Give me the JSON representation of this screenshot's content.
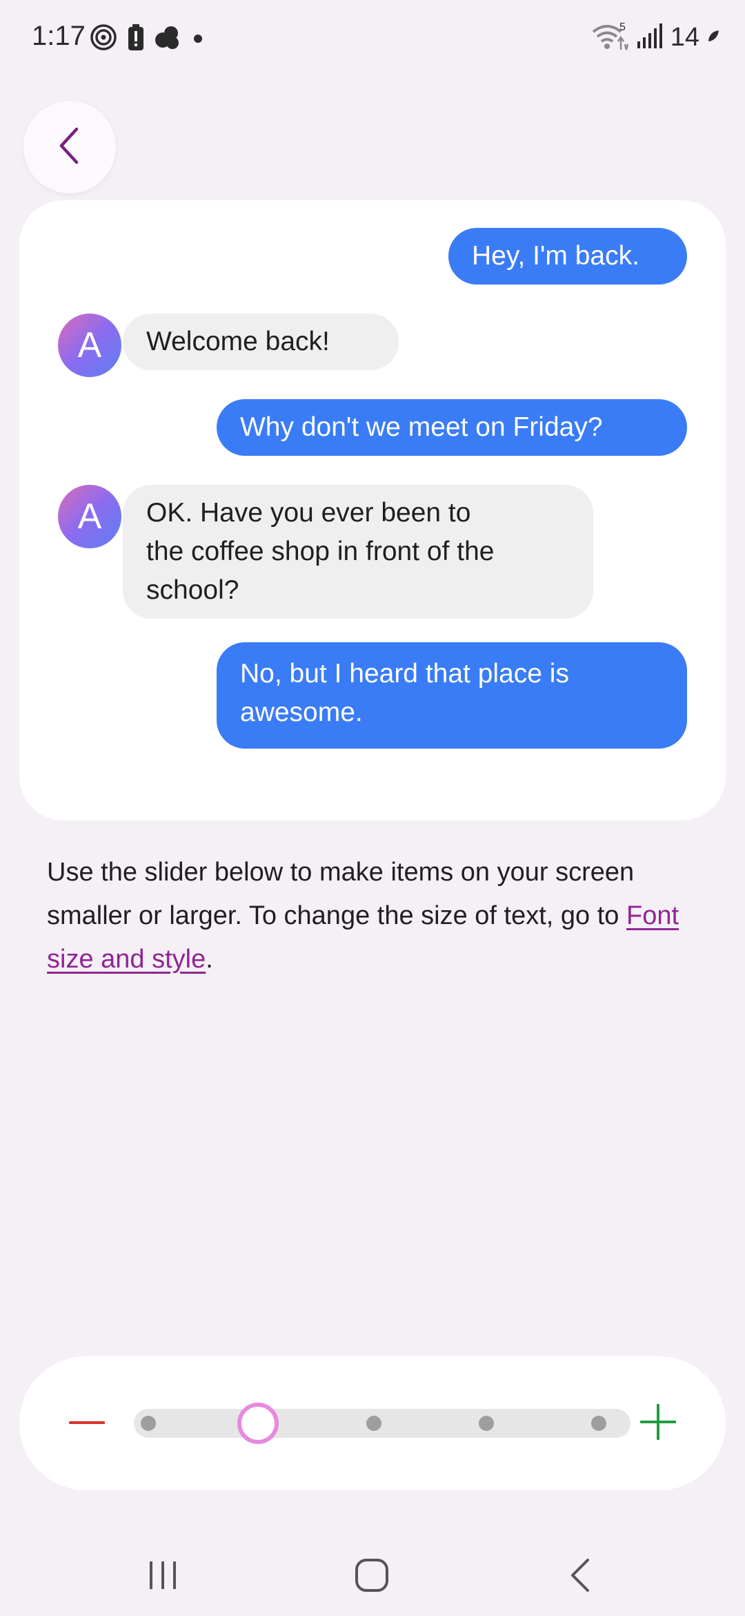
{
  "status_bar": {
    "time": "1:17",
    "left_icons": [
      "nfc-icon",
      "battery-alert-icon",
      "cloud-icon",
      "dot-icon"
    ],
    "right_icons": [
      "wifi-icon",
      "signal-icon"
    ],
    "wifi_badge": "5",
    "battery_text": "14"
  },
  "header": {
    "back_icon": "chevron-left-icon"
  },
  "chat": {
    "messages": [
      {
        "type": "sent",
        "text": "Hey, I'm back."
      },
      {
        "type": "received",
        "avatar": "A",
        "text": "Welcome back!"
      },
      {
        "type": "sent",
        "text": "Why don't we meet on Friday?"
      },
      {
        "type": "received",
        "avatar": "A",
        "lines": [
          "OK. Have you ever been to",
          "the coffee shop in front of the",
          "school?"
        ]
      },
      {
        "type": "sent",
        "lines": [
          "No, but I heard that place is",
          "awesome."
        ]
      }
    ]
  },
  "description": {
    "text": "Use the slider below to make items on your screen smaller or larger. To change the size of text, go to ",
    "link": "Font size and style",
    "suffix": "."
  },
  "slider": {
    "steps": 5,
    "selected_index": 1,
    "minus_icon": "minus-icon",
    "plus_icon": "plus-icon",
    "colors": {
      "minus": "#d9322b",
      "plus": "#1f9d3f",
      "thumb": "#e889e0"
    }
  },
  "nav_bar": {
    "items": [
      "recents-icon",
      "home-icon",
      "back-icon"
    ]
  },
  "colors": {
    "background": "#f5f0f6",
    "sent_bubble": "#3a7cf5",
    "received_bubble": "#efefef",
    "link": "#8f2594",
    "accent": "#7a1f7d"
  }
}
